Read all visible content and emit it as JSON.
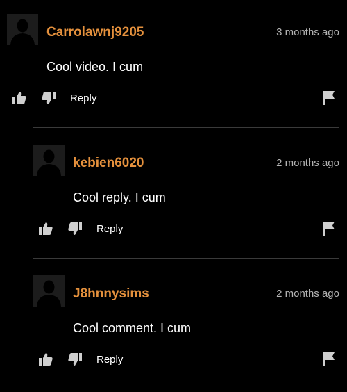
{
  "colors": {
    "username": "#e5913d",
    "timestamp": "#b3b3b3",
    "text": "#ffffff",
    "icon": "#cfcfcf",
    "divider": "#3a3a3a",
    "background": "#000000"
  },
  "comments": [
    {
      "username": "Carrolawnj9205",
      "time": "3 months ago",
      "text": "Cool video. I cum",
      "reply_label": "Reply",
      "avatar_icon": "default-avatar-icon"
    },
    {
      "username": "kebien6020",
      "time": "2 months ago",
      "text": "Cool reply. I cum",
      "reply_label": "Reply",
      "avatar_icon": "default-avatar-icon"
    },
    {
      "username": "J8hnnysims",
      "time": "2 months ago",
      "text": "Cool comment. I cum",
      "reply_label": "Reply",
      "avatar_icon": "default-avatar-icon"
    }
  ]
}
